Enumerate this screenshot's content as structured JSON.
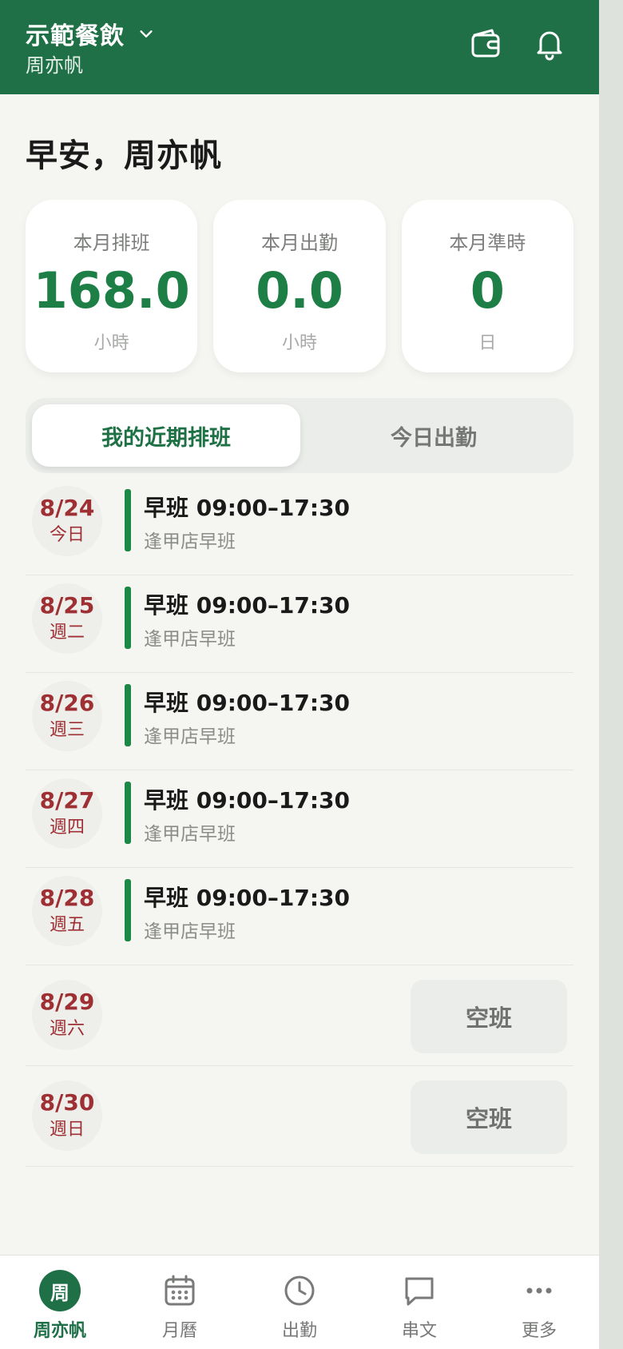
{
  "header": {
    "org_name": "示範餐飲",
    "user_name": "周亦帆"
  },
  "greeting": "早安，周亦帆",
  "stats": [
    {
      "label": "本月排班",
      "value": "168.0",
      "unit": "小時"
    },
    {
      "label": "本月出勤",
      "value": "0.0",
      "unit": "小時"
    },
    {
      "label": "本月準時",
      "value": "0",
      "unit": "日"
    }
  ],
  "tabs": [
    {
      "label": "我的近期排班",
      "active": true
    },
    {
      "label": "今日出勤",
      "active": false
    }
  ],
  "schedule": [
    {
      "date": "8/24",
      "day": "今日",
      "title": "早班 09:00–17:30",
      "location": "逢甲店早班"
    },
    {
      "date": "8/25",
      "day": "週二",
      "title": "早班 09:00–17:30",
      "location": "逢甲店早班"
    },
    {
      "date": "8/26",
      "day": "週三",
      "title": "早班 09:00–17:30",
      "location": "逢甲店早班"
    },
    {
      "date": "8/27",
      "day": "週四",
      "title": "早班 09:00–17:30",
      "location": "逢甲店早班"
    },
    {
      "date": "8/28",
      "day": "週五",
      "title": "早班 09:00–17:30",
      "location": "逢甲店早班"
    },
    {
      "date": "8/29",
      "day": "週六",
      "empty_label": "空班"
    },
    {
      "date": "8/30",
      "day": "週日",
      "empty_label": "空班"
    }
  ],
  "bottom_nav": [
    {
      "label": "周亦帆",
      "icon": "avatar",
      "avatar_text": "周",
      "active": true
    },
    {
      "label": "月曆",
      "icon": "calendar-icon"
    },
    {
      "label": "出勤",
      "icon": "clock-icon"
    },
    {
      "label": "串文",
      "icon": "chat-icon"
    },
    {
      "label": "更多",
      "icon": "more-icon"
    }
  ],
  "colors": {
    "brand": "#1f7047",
    "accent_green": "#1d7f45",
    "date_red": "#9e2f33",
    "background": "#f5f5f1"
  }
}
